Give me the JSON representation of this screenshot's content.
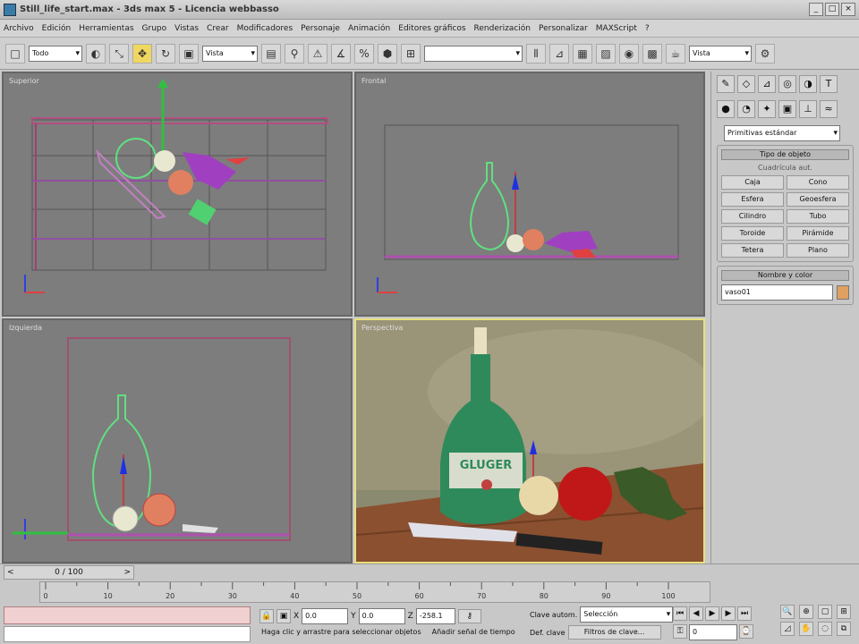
{
  "window": {
    "title": "Still_life_start.max - 3ds max 5 - Licencia webbasso",
    "minimize": "_",
    "maximize": "□",
    "close": "×"
  },
  "menu": [
    "Archivo",
    "Edición",
    "Herramientas",
    "Grupo",
    "Vistas",
    "Crear",
    "Modificadores",
    "Personaje",
    "Animación",
    "Editores gráficos",
    "Renderización",
    "Personalizar",
    "MAXScript",
    "?"
  ],
  "toolbar": {
    "filter_select": "Todo",
    "coord_select": "Vista",
    "named_sel": "",
    "render_select": "Vista"
  },
  "viewports": [
    {
      "label": "Superior",
      "active": false
    },
    {
      "label": "Frontal",
      "active": false
    },
    {
      "label": "Izquierda",
      "active": false
    },
    {
      "label": "Perspectiva",
      "active": true
    }
  ],
  "bottle_label": "GLUGER",
  "command_panel": {
    "category_select": "Primitivas estándar",
    "object_type_header": "Tipo de objeto",
    "autogrid": "Cuadrícula aut.",
    "buttons": [
      "Caja",
      "Cono",
      "Esfera",
      "Geoesfera",
      "Cilindro",
      "Tubo",
      "Toroide",
      "Pirámide",
      "Tetera",
      "Plano"
    ],
    "name_color_header": "Nombre y color",
    "name_value": "vaso01",
    "swatch_color": "#e0a060"
  },
  "timeline": {
    "frame_label": "0 / 100",
    "ticks": [
      "0",
      "10",
      "20",
      "30",
      "40",
      "50",
      "60",
      "70",
      "80",
      "90",
      "100"
    ]
  },
  "status": {
    "prompt": "Haga clic y arrastre para seleccionar objetos",
    "add_time_tag": "Añadir señal de tiempo",
    "x_value": "0.0",
    "y_value": "0.0",
    "z_value": "-258.1",
    "key_mode_label": "Clave autom.",
    "key_mode_select": "Selección",
    "set_key_label": "Def. clave",
    "key_filters": "Filtros de clave...",
    "frame_value": "0"
  }
}
